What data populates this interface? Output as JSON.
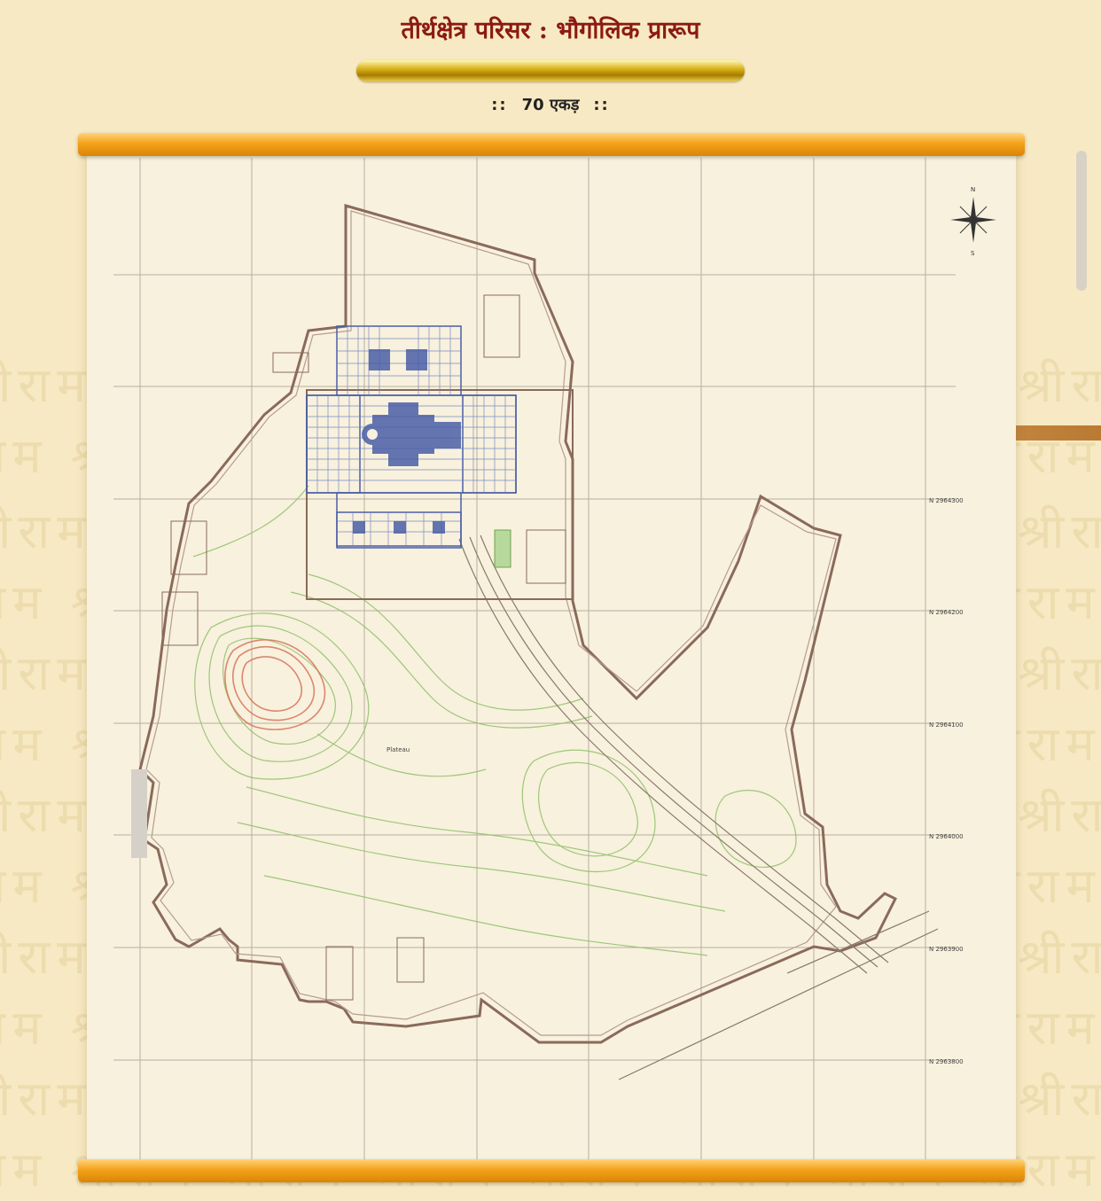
{
  "header": {
    "title": "तीर्थक्षेत्र परिसर : भौगोलिक प्रारूप",
    "area_prefix": "::",
    "area_value": "70 एकड़",
    "area_suffix": "::"
  },
  "map": {
    "northings": [
      "N 2964300",
      "N 2964200",
      "N 2964100",
      "N 2964000",
      "N 2963900",
      "N 2963800"
    ],
    "site_label": "Plateau",
    "compass_north": "N",
    "compass_south": "S"
  },
  "watermark": {
    "text": "श्रीराम"
  },
  "colors": {
    "title": "#8b1a12",
    "scroll_rod": "#f4a21a",
    "gold_bar": "#d9b21a",
    "paper": "#f8f1dd",
    "boundary": "#8a6a5a",
    "temple": "#4a5fa8",
    "contours_green": "#8fbf6a",
    "contours_red": "#d7745a"
  }
}
